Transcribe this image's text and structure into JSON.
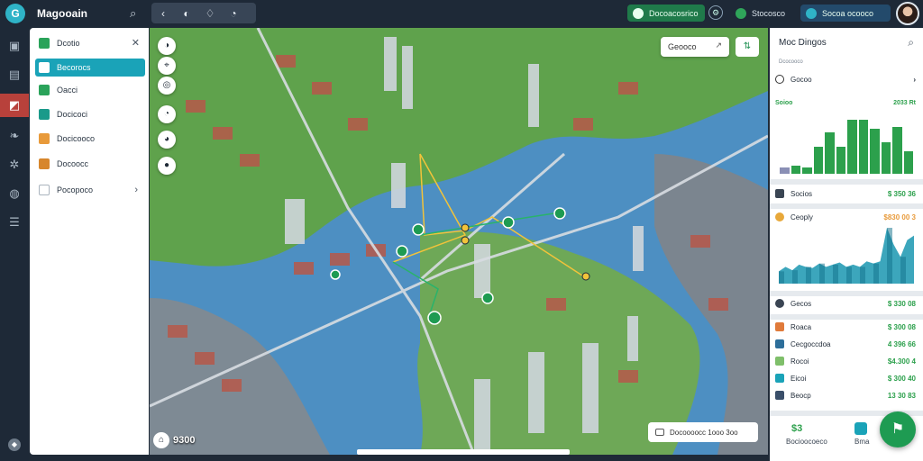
{
  "app": {
    "title": "Magooain",
    "logo": "G"
  },
  "topbar": {
    "search_icon": "search-icon",
    "tools": [
      "‹",
      "◐",
      "♢",
      "◔"
    ],
    "status_a": "Docoacosrico",
    "status_b": "Stocosco",
    "status_c": "Socoa ocooco"
  },
  "sidebar": {
    "items": [
      {
        "label": "Dcotio",
        "color": "#2aa35a"
      },
      {
        "label": "Becorocs",
        "color": "#1aa3b8"
      },
      {
        "label": "Oacci",
        "color": "#2aa35a"
      },
      {
        "label": "Docicoci",
        "color": "#1a9a8a"
      },
      {
        "label": "Docicooco",
        "color": "#e89a3a"
      },
      {
        "label": "Docoocc",
        "color": "#d7862c"
      },
      {
        "label": "Pocopoco",
        "color": "#c6cdd4"
      }
    ]
  },
  "map": {
    "search_label": "Geooco",
    "zoom_label": "9300",
    "route_label": "Docoooocc 1ooo 3oo",
    "colors": {
      "water": "#4d8fc2",
      "land": "#5aa04a",
      "route": "#f2c33a",
      "accent": "#29b36b"
    }
  },
  "right_panel": {
    "title": "Moc Dingos",
    "subtitle": "Dcocooco",
    "row1": {
      "label": "Gocoo",
      "value": ""
    },
    "sec1": {
      "label": "Soioo",
      "value": "2033 Rt"
    },
    "sec2": {
      "label": "Socios",
      "value": "$ 350 36"
    },
    "sec3": {
      "label": "Ceoply",
      "value": "$830 00 3"
    },
    "sec4": {
      "label": "Gecos",
      "value": "$ 330 08"
    },
    "list": [
      {
        "label": "Roaca",
        "value": "$ 300 08",
        "color": "#e07a3a"
      },
      {
        "label": "Cecgoccdoa",
        "value": "4 396 66",
        "color": "#2d6e9a"
      },
      {
        "label": "Rocoi",
        "value": "$4.300 4",
        "color": "#7fbf6a"
      },
      {
        "label": "Eicoi",
        "value": "$ 300 40",
        "color": "#1aa3b8"
      },
      {
        "label": "Beocp",
        "value": "13 30 83",
        "color": "#3a4f6a"
      }
    ],
    "kpi_left_value": "$3",
    "kpi_left_label": "Bocioocoeco",
    "kpi_mid_label": "Bma",
    "chart_data": [
      {
        "type": "bar",
        "values": [
          0.1,
          0.12,
          0.1,
          0.42,
          0.64,
          0.42,
          0.84,
          0.84,
          0.7,
          0.48,
          0.72,
          0.35
        ],
        "color": "#2ca04c"
      },
      {
        "type": "area",
        "values": [
          0.22,
          0.3,
          0.24,
          0.34,
          0.3,
          0.28,
          0.36,
          0.3,
          0.34,
          0.38,
          0.3,
          0.34,
          0.3,
          0.4,
          0.36,
          0.4,
          1.0,
          0.7,
          0.48,
          0.78,
          0.86
        ],
        "color": "#1a96b0"
      }
    ]
  }
}
